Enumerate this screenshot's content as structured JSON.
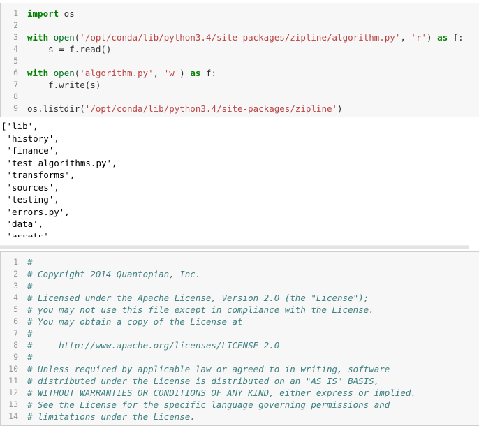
{
  "cell_one": {
    "line_numbers": [
      "1",
      "2",
      "3",
      "4",
      "5",
      "6",
      "7",
      "8",
      "9"
    ],
    "lines": [
      [
        {
          "t": "import",
          "c": "kw"
        },
        {
          "t": " os",
          "c": "pln"
        }
      ],
      [],
      [
        {
          "t": "with",
          "c": "kw"
        },
        {
          "t": " ",
          "c": "pln"
        },
        {
          "t": "open",
          "c": "bi"
        },
        {
          "t": "(",
          "c": "pln"
        },
        {
          "t": "'/opt/conda/lib/python3.4/site-packages/zipline/algorithm.py'",
          "c": "str"
        },
        {
          "t": ", ",
          "c": "pln"
        },
        {
          "t": "'r'",
          "c": "str"
        },
        {
          "t": ") ",
          "c": "pln"
        },
        {
          "t": "as",
          "c": "kw"
        },
        {
          "t": " f:",
          "c": "pln"
        }
      ],
      [
        {
          "t": "    s = f.read()",
          "c": "pln"
        }
      ],
      [],
      [
        {
          "t": "with",
          "c": "kw"
        },
        {
          "t": " ",
          "c": "pln"
        },
        {
          "t": "open",
          "c": "bi"
        },
        {
          "t": "(",
          "c": "pln"
        },
        {
          "t": "'algorithm.py'",
          "c": "str"
        },
        {
          "t": ", ",
          "c": "pln"
        },
        {
          "t": "'w'",
          "c": "str"
        },
        {
          "t": ") ",
          "c": "pln"
        },
        {
          "t": "as",
          "c": "kw"
        },
        {
          "t": " f:",
          "c": "pln"
        }
      ],
      [
        {
          "t": "    f.write(s)",
          "c": "pln"
        }
      ],
      [],
      [
        {
          "t": "os.listdir(",
          "c": "pln"
        },
        {
          "t": "'/opt/conda/lib/python3.4/site-packages/zipline'",
          "c": "str"
        },
        {
          "t": ")",
          "c": "pln"
        }
      ]
    ]
  },
  "output": {
    "lines": [
      "['lib',",
      " 'history',",
      " 'finance',",
      " 'test_algorithms.py',",
      " 'transforms',",
      " 'sources',",
      " 'testing',",
      " 'errors.py',",
      " 'data',",
      " 'assets'"
    ]
  },
  "cell_two": {
    "line_numbers": [
      "1",
      "2",
      "3",
      "4",
      "5",
      "6",
      "7",
      "8",
      "9",
      "10",
      "11",
      "12",
      "13",
      "14"
    ],
    "lines": [
      "#",
      "# Copyright 2014 Quantopian, Inc.",
      "#",
      "# Licensed under the Apache License, Version 2.0 (the \"License\");",
      "# you may not use this file except in compliance with the License.",
      "# You may obtain a copy of the License at",
      "#",
      "#     http://www.apache.org/licenses/LICENSE-2.0",
      "#",
      "# Unless required by applicable law or agreed to in writing, software",
      "# distributed under the License is distributed on an \"AS IS\" BASIS,",
      "# WITHOUT WARRANTIES OR CONDITIONS OF ANY KIND, either express or implied.",
      "# See the License for the specific language governing permissions and",
      "# limitations under the License."
    ]
  },
  "colors": {
    "keyword": "#008000",
    "string": "#bb4444",
    "builtin": "#007020",
    "comment": "#408080",
    "plain": "#303030",
    "cell_background": "#f7f7f7",
    "cell_border": "#cfcfcf",
    "gutter_text": "#999999",
    "divider": "#e3e3e3"
  }
}
